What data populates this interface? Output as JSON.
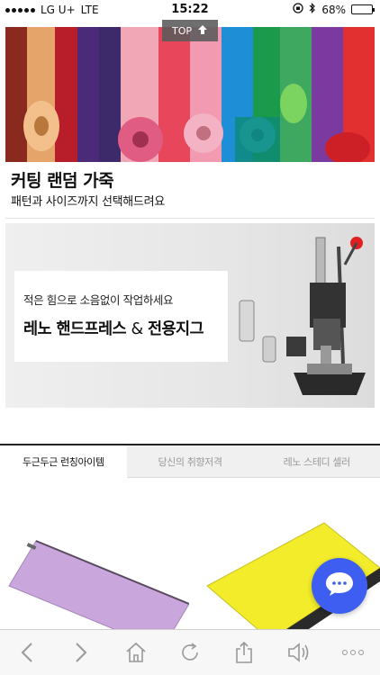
{
  "status": {
    "carrier": "LG U+",
    "network": "LTE",
    "time": "15:22",
    "battery": "68%",
    "battery_level": 0.68
  },
  "top_button": {
    "label": "TOP"
  },
  "hero": {
    "title": "커팅 랜덤 가죽",
    "subtitle": "패턴과 사이즈까지 선택해드려요"
  },
  "press_banner": {
    "line1": "적은 힘으로 소음없이 작업하세요",
    "line2_a": "레노 핸드프레스",
    "line2_amp": "&",
    "line2_b": "전용지그"
  },
  "tabs": [
    {
      "label": "두근두근 런칭아이템",
      "active": true
    },
    {
      "label": "당신의 취향저격",
      "active": false
    },
    {
      "label": "레노 스테디 셀러",
      "active": false
    }
  ],
  "products": [
    {
      "name": "purple-pouch",
      "color": "#c9a7dc"
    },
    {
      "name": "yellow-card-case",
      "color": "#f2ec2a"
    }
  ],
  "browser_bar": {
    "icons": [
      "back-icon",
      "forward-icon",
      "home-icon",
      "reload-icon",
      "share-icon",
      "sound-icon",
      "more-icon"
    ]
  },
  "colors": {
    "accent": "#3d5ef0"
  }
}
